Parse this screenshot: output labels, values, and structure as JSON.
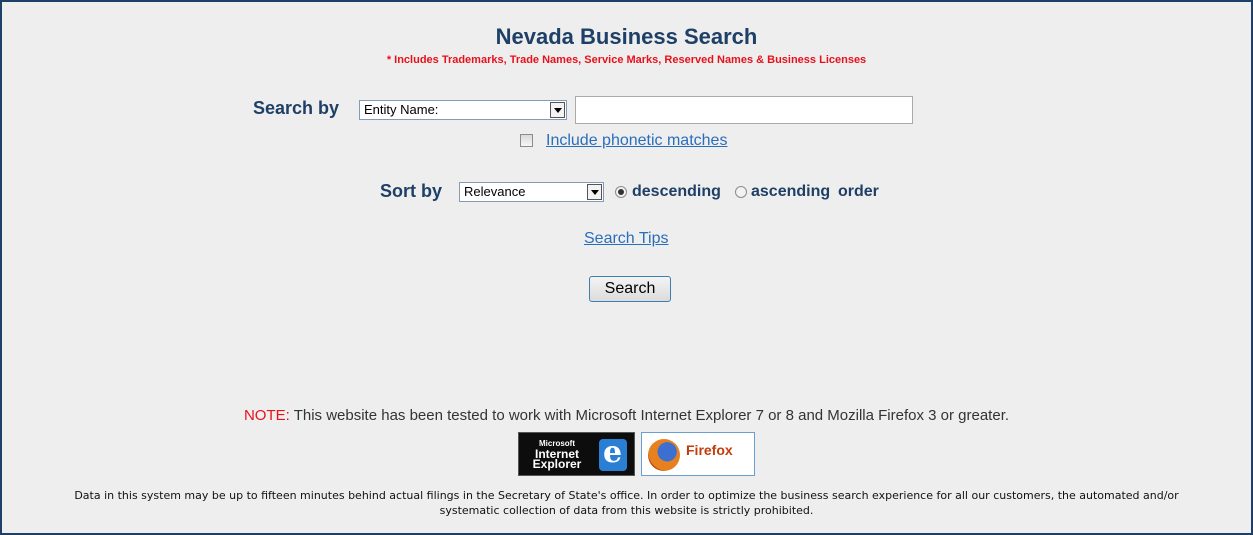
{
  "header": {
    "title": "Nevada Business Search",
    "subtitle": "* Includes Trademarks, Trade Names, Service Marks, Reserved Names & Business Licenses"
  },
  "search": {
    "label": "Search by",
    "field_select": "Entity Name:",
    "query_value": "",
    "phonetic_label": "Include phonetic matches",
    "phonetic_checked": false
  },
  "sort": {
    "label": "Sort by",
    "select_value": "Relevance",
    "descending_label": "descending",
    "ascending_label": "ascending",
    "order_label": "order",
    "selected_order": "descending"
  },
  "links": {
    "search_tips": "Search Tips"
  },
  "buttons": {
    "search": "Search"
  },
  "note": {
    "label": "NOTE:",
    "text": "This website has been tested to work with Microsoft Internet Explorer 7 or 8 and Mozilla Firefox 3 or greater."
  },
  "badges": {
    "ie_line1": "Microsoft",
    "ie_line2": "Internet",
    "ie_line3": "Explorer",
    "firefox_name": "Firefox"
  },
  "disclaimer": "Data in this system may be up to fifteen minutes behind actual filings in the Secretary of State's office.  In order to optimize the business search experience for all our customers, the automated and/or systematic collection of data from this website is strictly prohibited.",
  "colors": {
    "title": "#1e3f66",
    "accent_red": "#e8111b",
    "link": "#2a6ebb",
    "background": "#eeeeee"
  }
}
